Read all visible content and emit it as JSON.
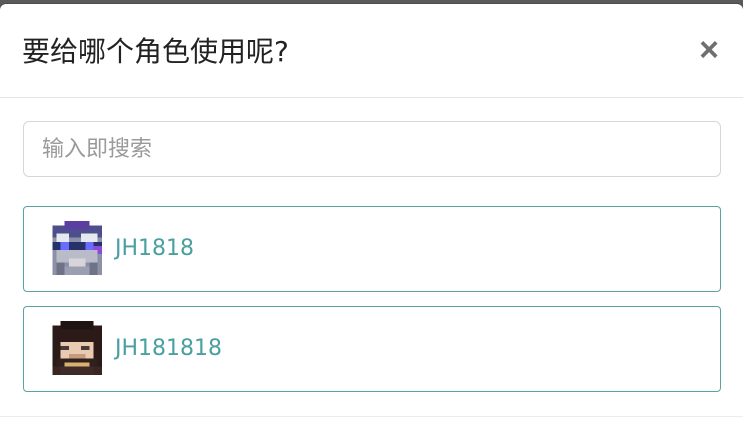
{
  "dialog": {
    "title": "要给哪个角色使用呢?",
    "close_label": "×"
  },
  "search": {
    "placeholder": "输入即搜索",
    "value": ""
  },
  "roles": [
    {
      "name": "JH1818",
      "avatar_icon": "pixel-skin-avatar-blue-icon"
    },
    {
      "name": "JH181818",
      "avatar_icon": "pixel-skin-avatar-brown-icon"
    }
  ],
  "colors": {
    "accent": "#4a9fa0",
    "item_border": "#5ba2a4"
  }
}
